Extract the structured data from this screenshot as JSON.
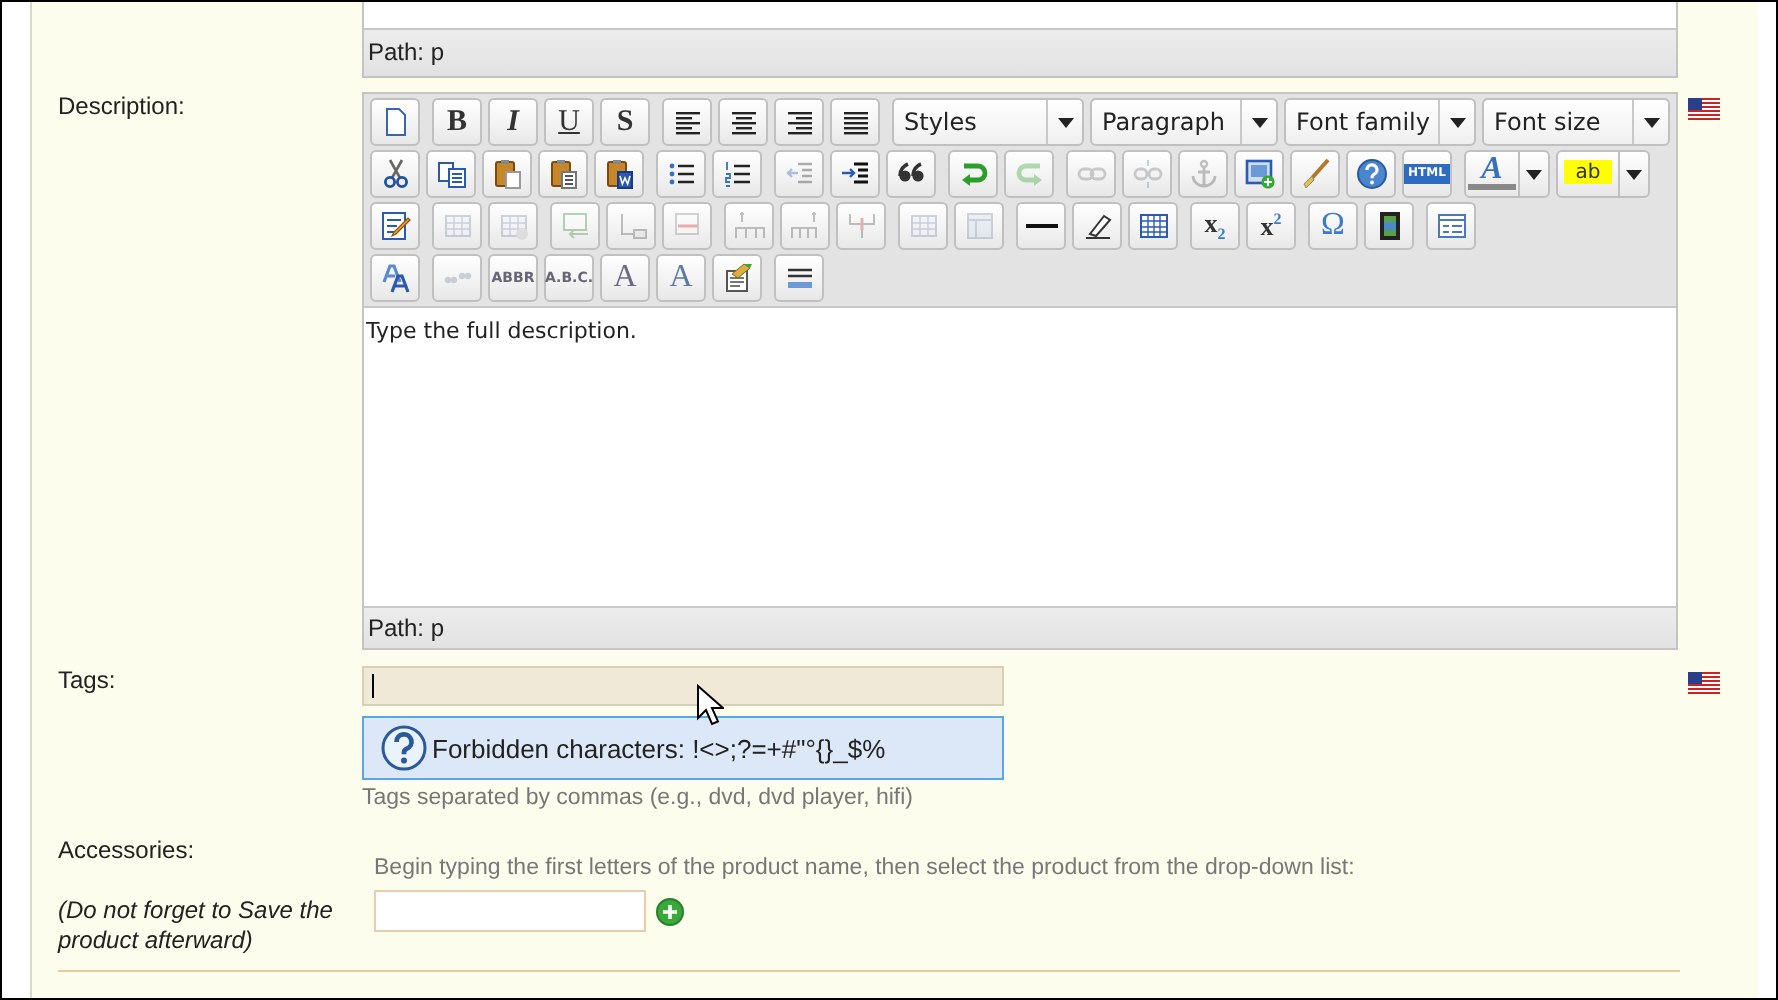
{
  "top_editor": {
    "path": "Path: p"
  },
  "description": {
    "label": "Description:",
    "toolbar": [
      {
        "groups": [
          {
            "items": [
              {
                "kind": "button",
                "disabled": false
              }
            ]
          },
          {
            "items": [
              {
                "kind": "button",
                "label": "B",
                "disabled": false
              },
              {
                "kind": "button",
                "label": "I",
                "disabled": false
              },
              {
                "kind": "button",
                "label": "U",
                "disabled": false
              },
              {
                "kind": "button",
                "label": "S",
                "disabled": false
              }
            ]
          },
          {
            "items": [
              {
                "kind": "button",
                "disabled": false
              },
              {
                "kind": "button",
                "disabled": false
              },
              {
                "kind": "button",
                "disabled": false
              },
              {
                "kind": "button",
                "disabled": false
              }
            ]
          },
          {
            "items": [
              {
                "kind": "select",
                "label": "Styles"
              },
              {
                "kind": "select",
                "label": "Paragraph"
              },
              {
                "kind": "select",
                "label": "Font family"
              },
              {
                "kind": "select",
                "label": "Font size"
              }
            ]
          }
        ]
      },
      {
        "groups": [
          {
            "items": [
              {
                "kind": "button",
                "disabled": false
              },
              {
                "kind": "button",
                "disabled": false
              },
              {
                "kind": "button",
                "disabled": false
              },
              {
                "kind": "button",
                "disabled": false
              },
              {
                "kind": "button",
                "disabled": false
              }
            ]
          },
          {
            "items": [
              {
                "kind": "button",
                "disabled": false
              },
              {
                "kind": "button",
                "disabled": false
              }
            ]
          },
          {
            "items": [
              {
                "kind": "button",
                "disabled": true
              },
              {
                "kind": "button",
                "disabled": false
              },
              {
                "kind": "button",
                "disabled": false
              }
            ]
          },
          {
            "items": [
              {
                "kind": "button",
                "disabled": false
              },
              {
                "kind": "button",
                "disabled": true
              }
            ]
          },
          {
            "items": [
              {
                "kind": "button",
                "disabled": true
              },
              {
                "kind": "button",
                "disabled": true
              },
              {
                "kind": "button",
                "disabled": true
              },
              {
                "kind": "button",
                "disabled": false
              },
              {
                "kind": "button",
                "disabled": false
              },
              {
                "kind": "button",
                "disabled": false
              },
              {
                "kind": "button",
                "label": "HTML",
                "disabled": false
              }
            ]
          },
          {
            "items": [
              {
                "kind": "split",
                "label": "A",
                "disabled": false
              },
              {
                "kind": "split",
                "label": "ab",
                "disabled": false
              }
            ]
          }
        ]
      },
      {
        "groups": [
          {
            "items": [
              {
                "kind": "button",
                "disabled": false
              }
            ]
          },
          {
            "items": [
              {
                "kind": "button",
                "disabled": true
              },
              {
                "kind": "button",
                "disabled": true
              }
            ]
          },
          {
            "items": [
              {
                "kind": "button",
                "disabled": true
              },
              {
                "kind": "button",
                "disabled": true
              },
              {
                "kind": "button",
                "disabled": true
              }
            ]
          },
          {
            "items": [
              {
                "kind": "button",
                "disabled": true
              },
              {
                "kind": "button",
                "disabled": true
              },
              {
                "kind": "button",
                "disabled": true
              }
            ]
          },
          {
            "items": [
              {
                "kind": "button",
                "disabled": true
              },
              {
                "kind": "button",
                "disabled": true
              }
            ]
          },
          {
            "items": [
              {
                "kind": "button",
                "disabled": false
              },
              {
                "kind": "button",
                "disabled": false
              },
              {
                "kind": "button",
                "disabled": false
              }
            ]
          },
          {
            "items": [
              {
                "kind": "button",
                "label": "x$_{2}$",
                "disabled": false
              },
              {
                "kind": "button",
                "label": "x$^{2}$",
                "disabled": false
              }
            ]
          },
          {
            "items": [
              {
                "kind": "button",
                "label": "Ω",
                "disabled": false
              },
              {
                "kind": "button",
                "disabled": false
              }
            ]
          },
          {
            "items": [
              {
                "kind": "button",
                "disabled": false
              }
            ]
          }
        ]
      },
      {
        "groups": [
          {
            "items": [
              {
                "kind": "button",
                "disabled": false
              }
            ]
          },
          {
            "items": [
              {
                "kind": "button",
                "disabled": true
              },
              {
                "kind": "button",
                "label": "ABBR",
                "disabled": true
              },
              {
                "kind": "button",
                "label": "A.B.C.",
                "disabled": true
              },
              {
                "kind": "button",
                "label": "A",
                "disabled": true
              },
              {
                "kind": "button",
                "label": "A",
                "disabled": true
              },
              {
                "kind": "button",
                "disabled": false
              }
            ]
          },
          {
            "items": [
              {
                "kind": "button",
                "disabled": false
              }
            ]
          }
        ]
      }
    ],
    "content": "Type the full description.",
    "path": "Path: p"
  },
  "tags": {
    "label": "Tags:",
    "focused": true,
    "tooltip": "Forbidden characters: !<>;?=+#\"°{}_$%",
    "hint": "Tags separated by commas (e.g., dvd, dvd player, hifi)"
  },
  "accessories": {
    "label": "Accessories:",
    "note": "(Do not forget to Save the product afterward)",
    "instructions": "Begin typing the first letters of the product name, then select the product from the drop-down list:"
  }
}
